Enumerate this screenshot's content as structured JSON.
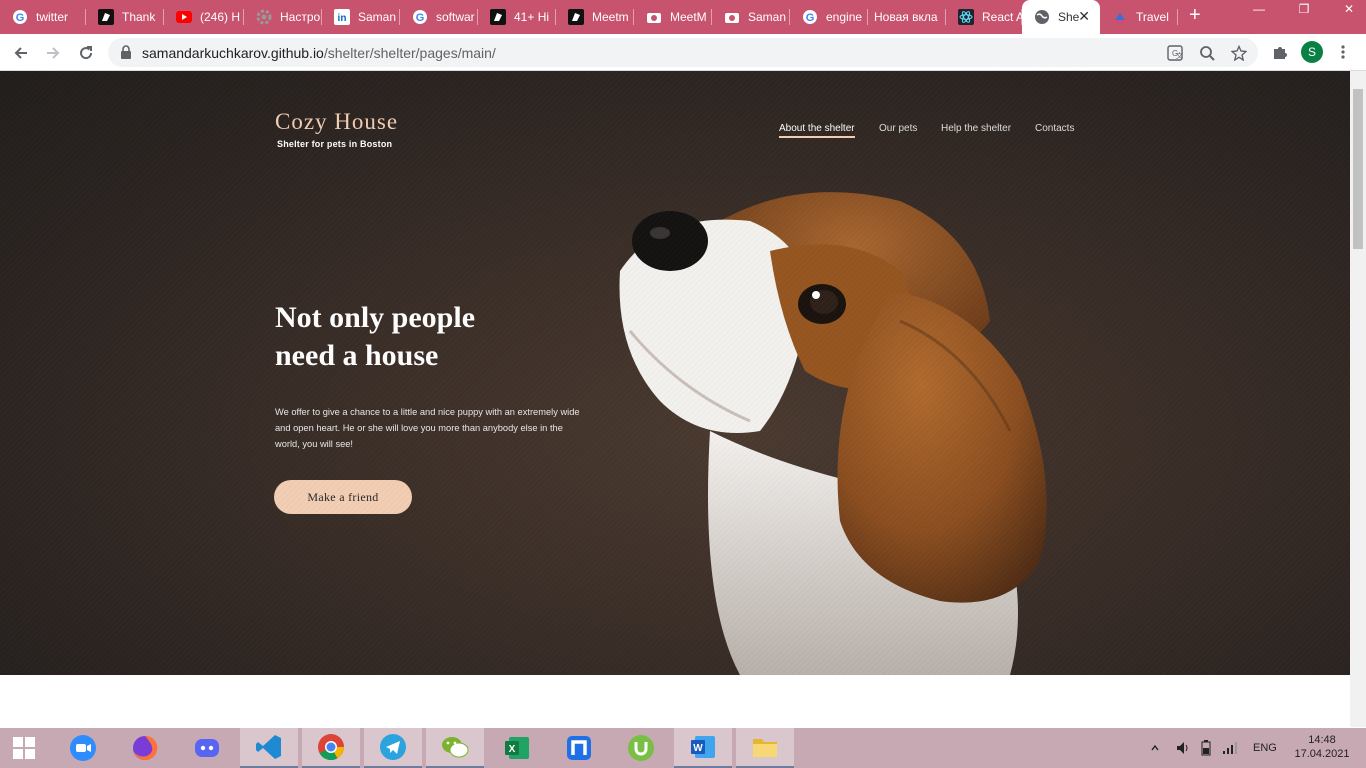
{
  "browser": {
    "tabs": [
      {
        "title": "twitter",
        "icon": "google-icon"
      },
      {
        "title": "Thank",
        "icon": "jumping-horse-icon"
      },
      {
        "title": "(246) H",
        "icon": "youtube-icon"
      },
      {
        "title": "Настро",
        "icon": "gear-icon"
      },
      {
        "title": "Saman",
        "icon": "linkedin-icon"
      },
      {
        "title": "softwar",
        "icon": "google-icon"
      },
      {
        "title": "41+ Hi",
        "icon": "jumping-horse-icon"
      },
      {
        "title": "Meetm",
        "icon": "jumping-horse-icon"
      },
      {
        "title": "MeetM",
        "icon": "camera-icon"
      },
      {
        "title": "Saman",
        "icon": "camera-icon"
      },
      {
        "title": "engine",
        "icon": "google-icon"
      },
      {
        "title": "Новая вкла",
        "icon": ""
      },
      {
        "title": "React A",
        "icon": "react-icon"
      },
      {
        "title": "She",
        "icon": "globe-icon",
        "active": true
      },
      {
        "title": "Travel",
        "icon": "travel-icon"
      }
    ],
    "url_host": "samandarkuchkarov.github.io",
    "url_path": "/shelter/shelter/pages/main/",
    "profile_initial": "S"
  },
  "page": {
    "logo_title": "Cozy House",
    "logo_subtitle": "Shelter for pets in Boston",
    "nav": [
      {
        "label": "About the shelter",
        "active": true
      },
      {
        "label": "Our pets"
      },
      {
        "label": "Help the shelter"
      },
      {
        "label": "Contacts"
      }
    ],
    "headline_line1": "Not only people",
    "headline_line2": "need a house",
    "lead": "We offer to give a chance to a little and nice puppy with an extremely wide and open heart. He or she will love you more than anybody else in the world, you will see!",
    "cta_label": "Make a friend",
    "colors": {
      "accent": "#f1cdb3",
      "hero_bg": "#3c2f28"
    }
  },
  "taskbar": {
    "apps": [
      "windows-start-icon",
      "zoom-icon",
      "firefox-icon",
      "discord-icon",
      "vscode-icon",
      "chrome-icon",
      "telegram-icon",
      "wechat-icon",
      "excel-icon",
      "n-app-icon",
      "utorrent-icon",
      "word-icon",
      "file-explorer-icon"
    ],
    "language": "ENG",
    "time": "14:48",
    "date": "17.04.2021"
  }
}
